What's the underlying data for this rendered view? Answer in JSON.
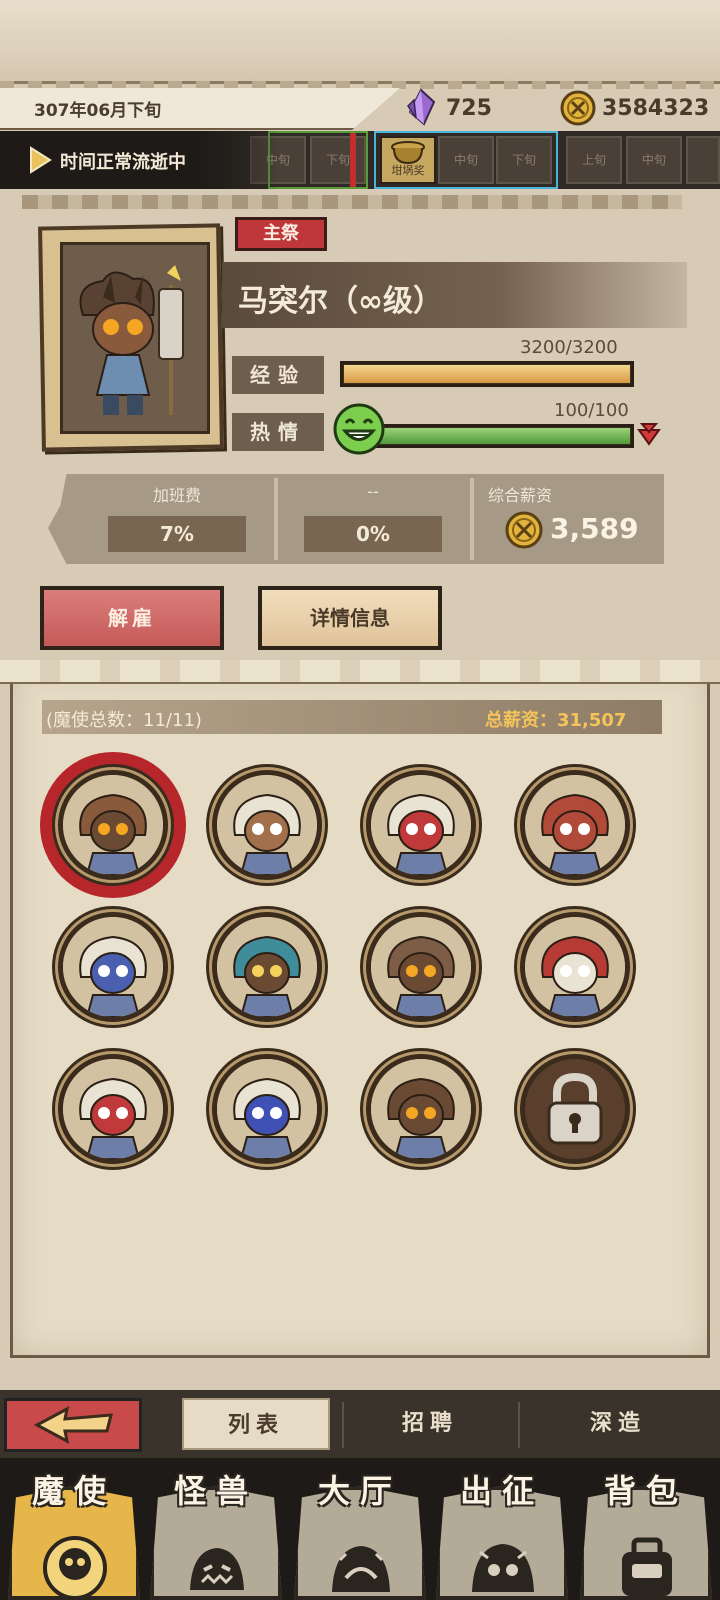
{
  "header": {
    "date": "307年06月下旬",
    "crystals": "725",
    "coins": "3584323"
  },
  "timeline": {
    "status": "时间正常流逝中",
    "cells": [
      "中旬",
      "下旬",
      "坩埚奖",
      "中旬",
      "下旬",
      "上旬",
      "中旬"
    ]
  },
  "character": {
    "role": "主祭",
    "name": "马突尔（∞级）",
    "exp_label": "经验",
    "exp_value": "3200/3200",
    "exp_ratio": 1.0,
    "passion_label": "热情",
    "passion_value": "100/100",
    "passion_ratio": 1.0
  },
  "salary": {
    "overtime_label": "加班费",
    "overtime_value": "7%",
    "other_label": "--",
    "other_value": "0%",
    "total_label": "综合薪资",
    "total_value": "3,589"
  },
  "actions": {
    "fire": "解雇",
    "details": "详情信息"
  },
  "roster": {
    "count_text": "(魔使总数：11/11)",
    "payroll_text": "总薪资：31,507",
    "members": [
      {
        "id": "m1",
        "selected": true,
        "skin": "#8a5a3c",
        "mask": "#6b4a34",
        "eyes": "#f5a623"
      },
      {
        "id": "m2",
        "selected": false,
        "skin": "#e9e3d3",
        "mask": "#a2714c",
        "eyes": "#ffffff"
      },
      {
        "id": "m3",
        "selected": false,
        "skin": "#e9e3d3",
        "mask": "#c0393b",
        "eyes": "#ffffff"
      },
      {
        "id": "m4",
        "selected": false,
        "skin": "#b24a3a",
        "mask": "#b24a3a",
        "eyes": "#ffffff"
      },
      {
        "id": "m5",
        "selected": false,
        "skin": "#e9e3d3",
        "mask": "#4a5fb0",
        "eyes": "#ffffff"
      },
      {
        "id": "m6",
        "selected": false,
        "skin": "#3f8c9a",
        "mask": "#6b4a34",
        "eyes": "#f5d35a"
      },
      {
        "id": "m7",
        "selected": false,
        "skin": "#7d5d45",
        "mask": "#6b4a34",
        "eyes": "#f5a623"
      },
      {
        "id": "m8",
        "selected": false,
        "skin": "#b83a34",
        "mask": "#e9e3d3",
        "eyes": "#ffffff"
      },
      {
        "id": "m9",
        "selected": false,
        "skin": "#e9e3d3",
        "mask": "#c0393b",
        "eyes": "#ffffff"
      },
      {
        "id": "m10",
        "selected": false,
        "skin": "#e9e3d3",
        "mask": "#3f51b5",
        "eyes": "#ffffff"
      },
      {
        "id": "m11",
        "selected": false,
        "skin": "#6b4a34",
        "mask": "#6b4a34",
        "eyes": "#f5a623"
      },
      {
        "id": "locked",
        "selected": false,
        "locked": true
      }
    ]
  },
  "subtabs": {
    "list": "列表",
    "recruit": "招聘",
    "forge": "深造"
  },
  "nav": {
    "items": [
      "魔使",
      "怪兽",
      "大厅",
      "出征",
      "背包"
    ]
  },
  "colors": {
    "accent_red": "#c0373b",
    "gold": "#f5c35a",
    "passion_green": "#4f9a38"
  }
}
